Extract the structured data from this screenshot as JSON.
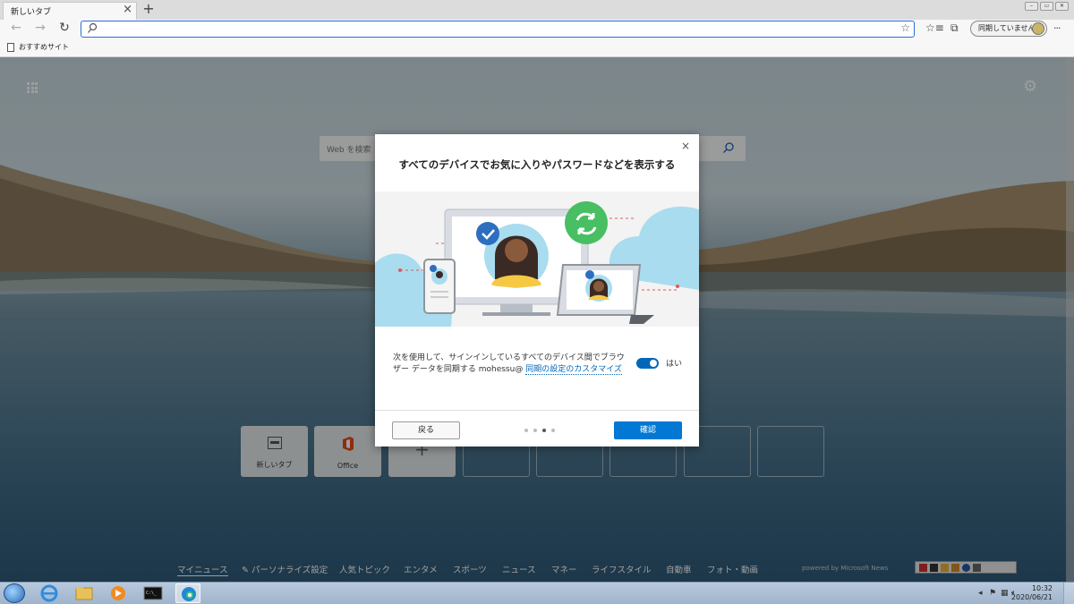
{
  "tab": {
    "title": "新しいタブ",
    "close_glyph": "×",
    "new_glyph": "+"
  },
  "toolbar": {
    "back_glyph": "←",
    "forward_glyph": "→",
    "refresh_glyph": "↻",
    "address_value": "",
    "sync_label": "同期していません",
    "more_glyph": "···"
  },
  "favorites": [
    {
      "label": "おすすめサイト",
      "icon": "page-icon"
    }
  ],
  "newtab": {
    "search_placeholder": "Web を検索",
    "tiles": [
      {
        "label": "新しいタブ",
        "icon": "newtab-icon",
        "kind": "site"
      },
      {
        "label": "Office",
        "icon": "office-icon",
        "kind": "site"
      },
      {
        "label": "",
        "icon": "plus-icon",
        "kind": "add"
      },
      {
        "label": "",
        "kind": "empty"
      },
      {
        "label": "",
        "kind": "empty"
      },
      {
        "label": "",
        "kind": "empty"
      },
      {
        "label": "",
        "kind": "empty"
      },
      {
        "label": "",
        "kind": "empty"
      }
    ],
    "news_nav": [
      "マイニュース",
      "✎ パーソナライズ設定",
      "人気トピック",
      "エンタメ",
      "スポーツ",
      "ニュース",
      "マネー",
      "ライフスタイル",
      "自動車",
      "フォト・動画"
    ],
    "powered_by": "powered by Microsoft News"
  },
  "modal": {
    "title": "すべてのデバイスでお気に入りやパスワードなどを表示する",
    "close_glyph": "×",
    "description": "次を使用して、サインインしているすべてのデバイス間でブラウザー データを同期する mohessu@",
    "customize_link": "同期の設定のカスタマイズ",
    "toggle_on": true,
    "toggle_label": "はい",
    "back_label": "戻る",
    "confirm_label": "確認",
    "steps_total": 4,
    "step_current": 3
  },
  "taskbar": {
    "time": "10:32",
    "date": "2020/06/21"
  },
  "colors": {
    "accent": "#0078d4",
    "link": "#0067b8",
    "sync_green": "#3fbf5f"
  }
}
